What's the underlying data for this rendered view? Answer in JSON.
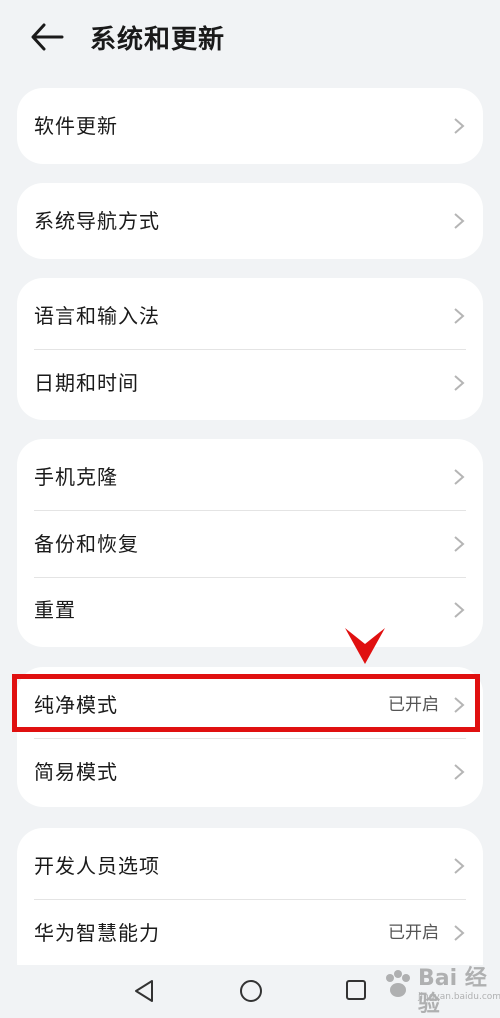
{
  "header": {
    "title": "系统和更新",
    "back_icon": "arrow-left-icon"
  },
  "sections": [
    {
      "items": [
        {
          "label": "软件更新",
          "value": ""
        }
      ]
    },
    {
      "items": [
        {
          "label": "系统导航方式",
          "value": ""
        }
      ]
    },
    {
      "items": [
        {
          "label": "语言和输入法",
          "value": ""
        },
        {
          "label": "日期和时间",
          "value": ""
        }
      ]
    },
    {
      "items": [
        {
          "label": "手机克隆",
          "value": ""
        },
        {
          "label": "备份和恢复",
          "value": ""
        },
        {
          "label": "重置",
          "value": ""
        }
      ]
    },
    {
      "items": [
        {
          "label": "纯净模式",
          "value": "已开启"
        },
        {
          "label": "简易模式",
          "value": ""
        }
      ]
    },
    {
      "items": [
        {
          "label": "开发人员选项",
          "value": ""
        },
        {
          "label": "华为智慧能力",
          "value": "已开启"
        }
      ]
    }
  ],
  "annotation": {
    "color": "#e01010",
    "highlighted_item": "纯净模式"
  },
  "navbar": {
    "icons": [
      "back-triangle-icon",
      "home-circle-icon",
      "recents-square-icon"
    ]
  },
  "watermark": {
    "text": "Bai 经验",
    "sub": "jingyan.baidu.com"
  }
}
